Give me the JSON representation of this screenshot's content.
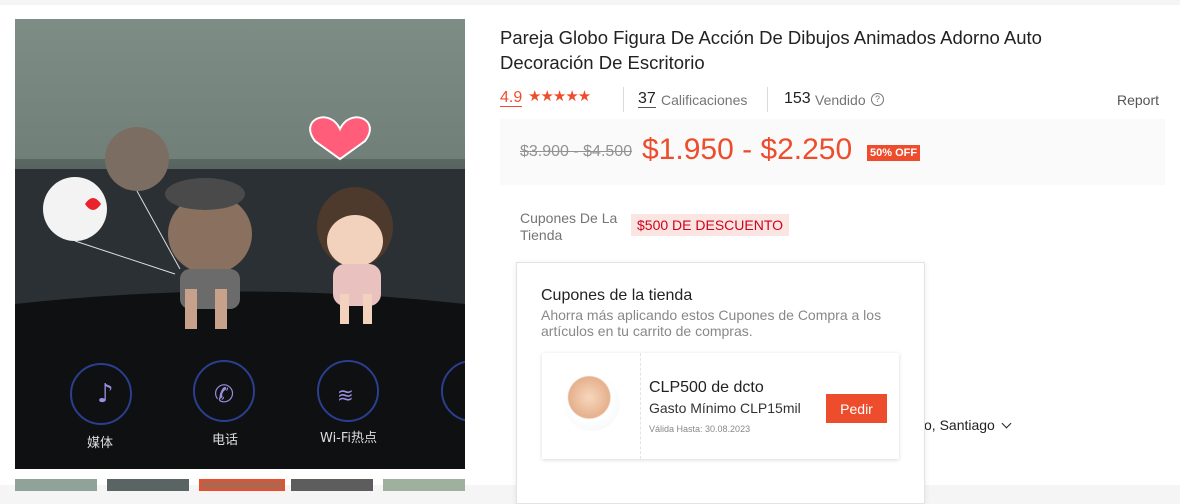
{
  "product": {
    "title": "Pareja Globo Figura De Acción De Dibujos Animados Adorno Auto Decoración De Escritorio",
    "rating": "4.9",
    "stars": "★★★★★",
    "ratings_count": "37",
    "ratings_label": "Calificaciones",
    "sold_count": "153",
    "sold_label": "Vendido",
    "help_icon": "?",
    "report_label": "Report"
  },
  "price": {
    "original": "$3.900 - $4.500",
    "current": "$1.950 - $2.250",
    "discount_badge": "50% OFF"
  },
  "image": {
    "dashboard_labels": [
      "媒体",
      "电话",
      "Wi-Fi热点"
    ]
  },
  "coupons": {
    "label": "Cupones De La Tienda",
    "tag": "$500 DE DESCUENTO",
    "popup": {
      "title": "Cupones de la tienda",
      "subtitle": "Ahorra más aplicando estos Cupones de Compra a los artículos en tu carrito de compras.",
      "voucher": {
        "title": "CLP500 de dcto",
        "min_spend": "Gasto Mínimo CLP15mil",
        "valid_until": "Válida Hasta: 30.08.2023",
        "button": "Pedir"
      }
    }
  },
  "shipping": {
    "location": "o, Santiago"
  },
  "colors": {
    "accent": "#ee4d2d",
    "tag_bg": "#fbe5e2",
    "tag_text": "#d0011b"
  }
}
